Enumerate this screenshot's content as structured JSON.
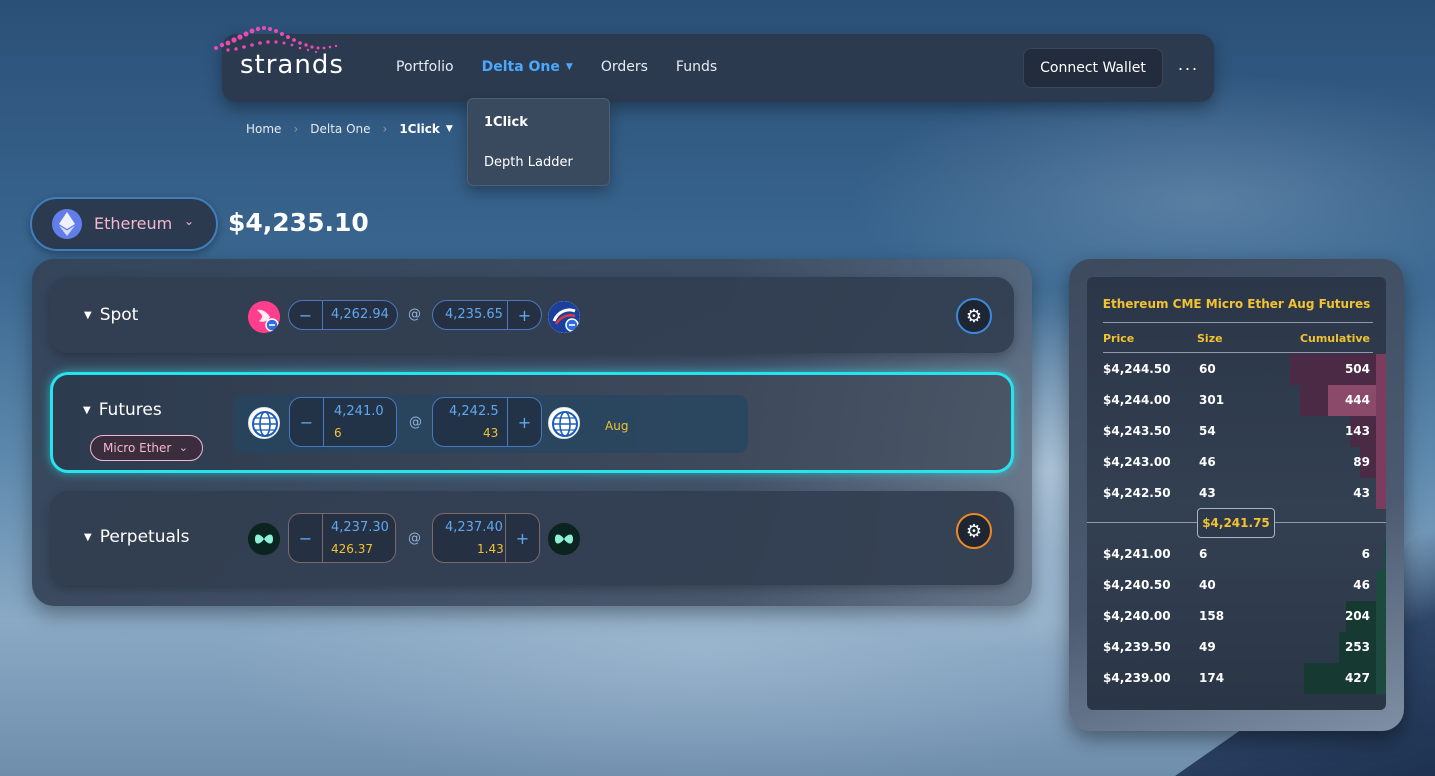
{
  "nav": {
    "logo": "strands",
    "links": [
      "Portfolio",
      "Delta One",
      "Orders",
      "Funds"
    ],
    "connect_label": "Connect Wallet",
    "more_label": "···"
  },
  "dropdown": {
    "items": [
      "1Click",
      "Depth Ladder"
    ]
  },
  "breadcrumb": {
    "home": "Home",
    "section": "Delta One",
    "current": "1Click"
  },
  "asset": {
    "name": "Ethereum",
    "price": "$4,235.10"
  },
  "rows": {
    "spot": {
      "label": "Spot",
      "bid": "4,262.94",
      "ask": "4,235.65",
      "at": "@"
    },
    "futures": {
      "label": "Futures",
      "contract": "Micro Ether",
      "bid": "4,241.0",
      "bid_size": "6",
      "ask": "4,242.5",
      "ask_size": "43",
      "at": "@",
      "month": "Aug"
    },
    "perps": {
      "label": "Perpetuals",
      "bid": "4,237.30",
      "bid_size": "426.37",
      "ask": "4,237.40",
      "ask_size": "1.43",
      "at": "@"
    }
  },
  "book": {
    "title": "Ethereum CME Micro Ether Aug Futures",
    "headers": {
      "price": "Price",
      "size": "Size",
      "cumulative": "Cumulative"
    },
    "asks": [
      {
        "price": "$4,244.50",
        "size": "60",
        "cum": "504"
      },
      {
        "price": "$4,244.00",
        "size": "301",
        "cum": "444"
      },
      {
        "price": "$4,243.50",
        "size": "54",
        "cum": "143"
      },
      {
        "price": "$4,243.00",
        "size": "46",
        "cum": "89"
      },
      {
        "price": "$4,242.50",
        "size": "43",
        "cum": "43"
      }
    ],
    "mid": "$4,241.75",
    "bids": [
      {
        "price": "$4,241.00",
        "size": "6",
        "cum": "6"
      },
      {
        "price": "$4,240.50",
        "size": "40",
        "cum": "46"
      },
      {
        "price": "$4,240.00",
        "size": "158",
        "cum": "204"
      },
      {
        "price": "$4,239.50",
        "size": "49",
        "cum": "253"
      },
      {
        "price": "$4,239.00",
        "size": "174",
        "cum": "427"
      }
    ]
  },
  "colors": {
    "accent_blue": "#4aa8ff",
    "gold": "#f2c230",
    "cyan": "#27e3ee",
    "pink": "#f5b7d0",
    "orange": "#f08a20"
  },
  "icons": [
    "ethereum-icon",
    "uniswap-icon",
    "venue-icon",
    "globe-icon",
    "hyperliquid-icon",
    "gear-icon",
    "chevron-down-icon"
  ]
}
